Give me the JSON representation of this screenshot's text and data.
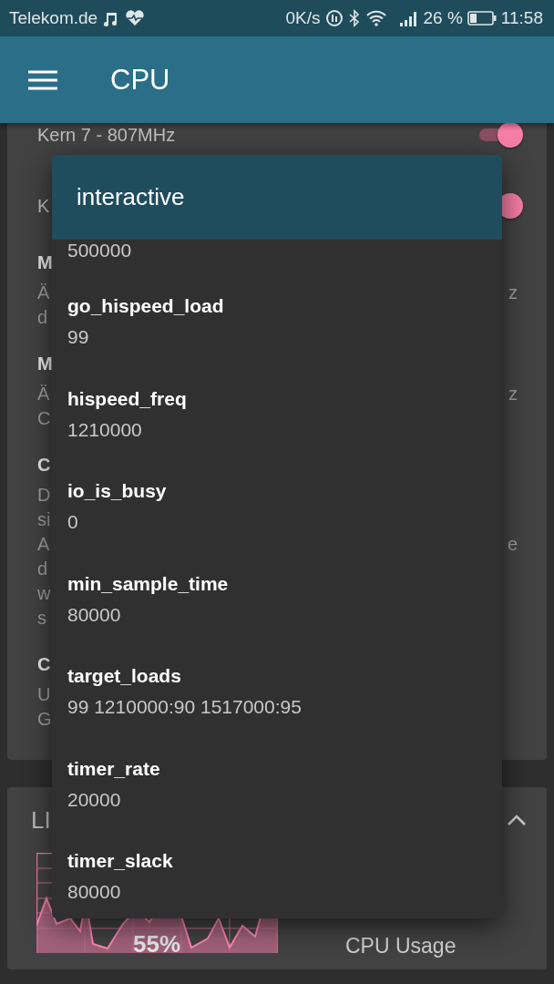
{
  "status_bar": {
    "carrier": "Telekom.de",
    "speed": "0K/s",
    "battery": "26 %",
    "time": "11:58"
  },
  "app_bar": {
    "title": "CPU"
  },
  "settings_card": {
    "items": [
      {
        "kind": "toggle",
        "title": "Kern 7 - 807MHz",
        "on": true
      },
      {
        "kind": "toggle",
        "title": "K",
        "on": true
      },
      {
        "kind": "text",
        "title": "M",
        "lines": [
          {
            "left": "Ä",
            "right": "z"
          },
          {
            "left": "d"
          }
        ]
      },
      {
        "kind": "text",
        "title": "M",
        "lines": [
          {
            "left": "Ä",
            "right": "z"
          },
          {
            "left": "C"
          }
        ]
      },
      {
        "kind": "text",
        "title": "C",
        "lines": [
          {
            "left": "D"
          },
          {
            "left": "si"
          },
          {
            "left": "A",
            "right": "e"
          },
          {
            "left": "d"
          },
          {
            "left": "w"
          },
          {
            "left": "s"
          }
        ]
      },
      {
        "kind": "text",
        "title": "C",
        "lines": [
          {
            "left": "U"
          },
          {
            "left": "G"
          }
        ]
      }
    ]
  },
  "usage_card": {
    "title": "LI",
    "expanded": true,
    "reading": "55%",
    "label": "CPU Usage"
  },
  "dialog": {
    "title": "interactive",
    "items": [
      {
        "value": "500000"
      },
      {
        "name": "go_hispeed_load",
        "value": "99"
      },
      {
        "name": "hispeed_freq",
        "value": "1210000"
      },
      {
        "name": "io_is_busy",
        "value": "0"
      },
      {
        "name": "min_sample_time",
        "value": "80000"
      },
      {
        "name": "target_loads",
        "value": "99 1210000:90 1517000:95"
      },
      {
        "name": "timer_rate",
        "value": "20000"
      },
      {
        "name": "timer_slack",
        "value": "80000"
      }
    ]
  }
}
